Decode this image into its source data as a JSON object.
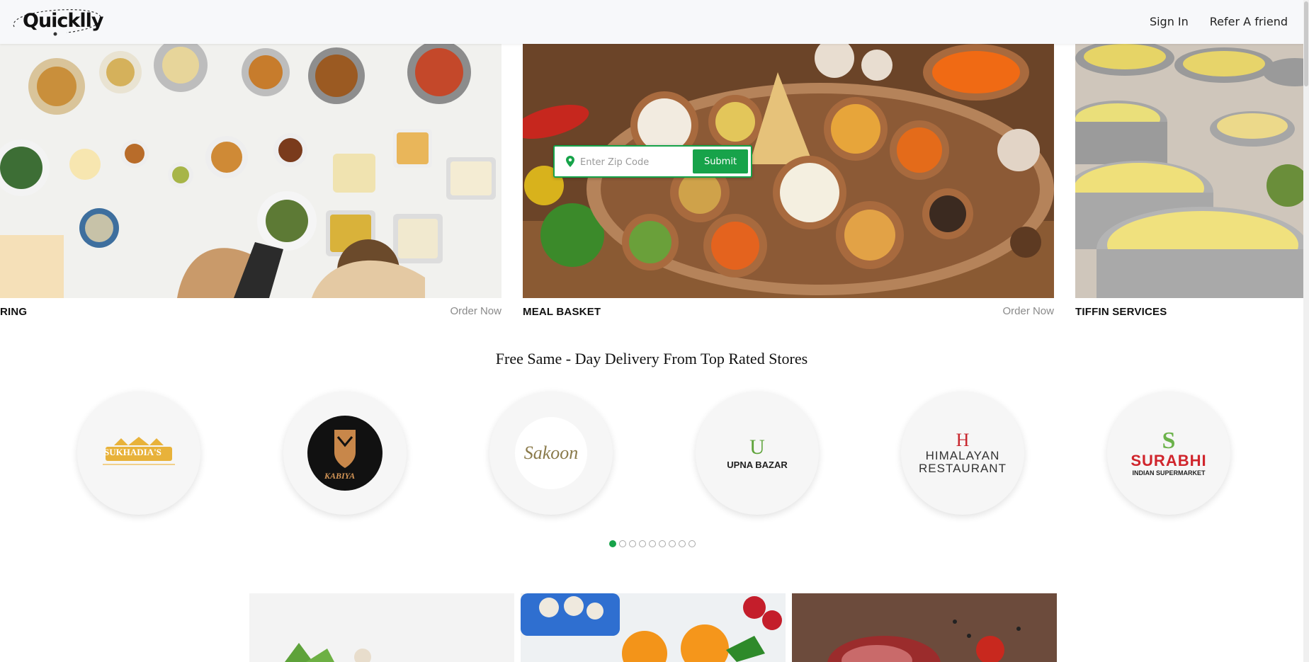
{
  "header": {
    "logo_text": "Quicklly",
    "nav": {
      "sign_in": "Sign In",
      "refer": "Refer A friend"
    }
  },
  "carousel": {
    "cards": [
      {
        "title": "RING",
        "order": "Order Now"
      },
      {
        "title": "MEAL BASKET",
        "order": "Order Now"
      },
      {
        "title": "TIFFIN SERVICES"
      }
    ]
  },
  "search": {
    "placeholder": "Enter Zip Code",
    "submit": "Submit"
  },
  "stores": {
    "title": "Free Same - Day Delivery From Top Rated Stores",
    "items": [
      {
        "name": "SUKHADIA'S"
      },
      {
        "name": "KABIYA"
      },
      {
        "name": "Sakoon"
      },
      {
        "letter": "U",
        "name": "UPNA BAZAR"
      },
      {
        "letter": "H",
        "name_line1": "HIMALAYAN",
        "name_line2": "RESTAURANT"
      },
      {
        "letter": "S",
        "name_line1": "SURABHI",
        "name_line2": "INDIAN SUPERMARKET"
      }
    ],
    "pagination": {
      "total": 9,
      "active": 1
    }
  },
  "colors": {
    "accent": "#17a34a",
    "surabhi_red": "#d0252c",
    "himalayan_red": "#c8262d",
    "sukhadia_gold": "#e8b23a"
  }
}
